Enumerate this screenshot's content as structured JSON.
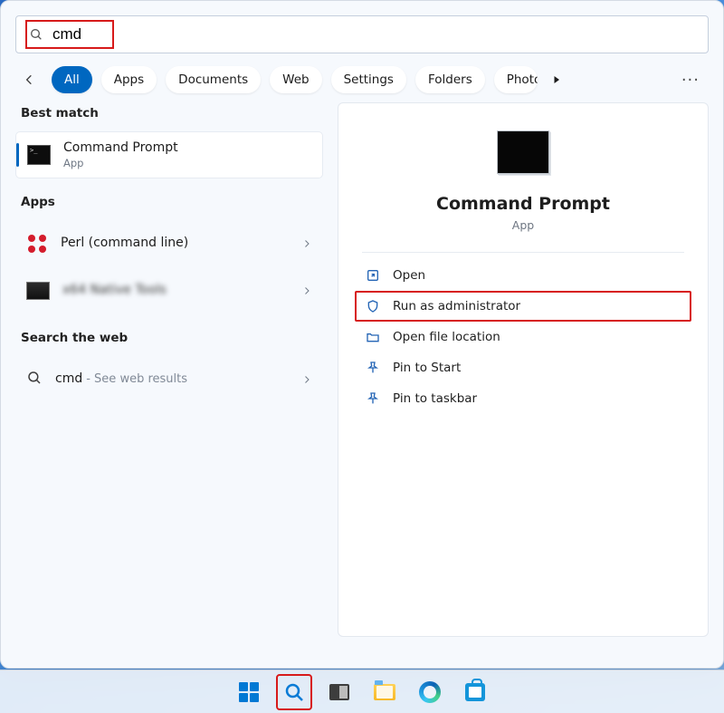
{
  "search": {
    "value": "cmd"
  },
  "filters": {
    "all": "All",
    "apps": "Apps",
    "documents": "Documents",
    "web": "Web",
    "settings": "Settings",
    "folders": "Folders",
    "photos": "Photos"
  },
  "left": {
    "best_match_h": "Best match",
    "best": {
      "title": "Command Prompt",
      "sub": "App"
    },
    "apps_h": "Apps",
    "app1": {
      "title": "Perl (command line)"
    },
    "app2": {
      "title": "x64 Native Tools"
    },
    "web_h": "Search the web",
    "web1": {
      "title": "cmd",
      "sub": "- See web results"
    }
  },
  "preview": {
    "title": "Command Prompt",
    "sub": "App",
    "actions": {
      "open": "Open",
      "run_admin": "Run as administrator",
      "open_loc": "Open file location",
      "pin_start": "Pin to Start",
      "pin_taskbar": "Pin to taskbar"
    }
  }
}
